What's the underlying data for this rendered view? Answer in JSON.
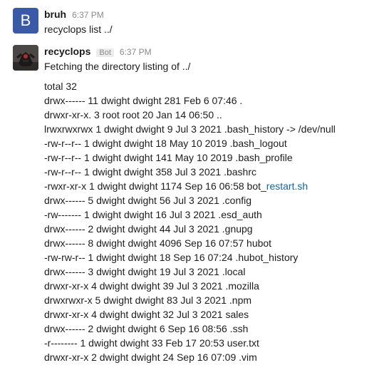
{
  "messages": [
    {
      "avatar_letter": "B",
      "username": "bruh",
      "time": "6:37 PM",
      "text": "recyclops list ../"
    },
    {
      "username": "recyclops",
      "badge": "Bot",
      "time": "6:37 PM",
      "text": "Fetching the directory listing of ../",
      "listing": [
        {
          "text": "total 32"
        },
        {
          "text": "drwx------ 11 dwight dwight 281 Feb 6 07:46 ."
        },
        {
          "text": "drwxr-xr-x. 3 root root 20 Jan 14 06:50 .."
        },
        {
          "text": "lrwxrwxrwx 1 dwight dwight 9 Jul 3 2021 .bash_history -> /dev/null"
        },
        {
          "text": "-rw-r--r-- 1 dwight dwight 18 May 10 2019 .bash_logout"
        },
        {
          "text": "-rw-r--r-- 1 dwight dwight 141 May 10 2019 .bash_profile"
        },
        {
          "text": "-rw-r--r-- 1 dwight dwight 358 Jul 3 2021 .bashrc"
        },
        {
          "text": "-rwxr-xr-x 1 dwight dwight 1174 Sep 16 06:58 bot_",
          "link": "restart.sh"
        },
        {
          "text": "drwx------ 5 dwight dwight 56 Jul 3 2021 .config"
        },
        {
          "text": "-rw------- 1 dwight dwight 16 Jul 3 2021 .esd_auth"
        },
        {
          "text": "drwx------ 2 dwight dwight 44 Jul 3 2021 .gnupg"
        },
        {
          "text": "drwx------ 8 dwight dwight 4096 Sep 16 07:57 hubot"
        },
        {
          "text": "-rw-rw-r-- 1 dwight dwight 18 Sep 16 07:24 .hubot_history"
        },
        {
          "text": "drwx------ 3 dwight dwight 19 Jul 3 2021 .local"
        },
        {
          "text": "drwxr-xr-x 4 dwight dwight 39 Jul 3 2021 .mozilla"
        },
        {
          "text": "drwxrwxr-x 5 dwight dwight 83 Jul 3 2021 .npm"
        },
        {
          "text": "drwxr-xr-x 4 dwight dwight 32 Jul 3 2021 sales"
        },
        {
          "text": "drwx------ 2 dwight dwight 6 Sep 16 08:56 .ssh"
        },
        {
          "text": "-r-------- 1 dwight dwight 33 Feb 17 20:53 user.txt"
        },
        {
          "text": "drwxr-xr-x 2 dwight dwight 24 Sep 16 07:09 .vim"
        }
      ]
    }
  ],
  "colors": {
    "avatar_b": "#3a5aa7",
    "link": "#1264a3",
    "muted": "#8a8a8a"
  }
}
